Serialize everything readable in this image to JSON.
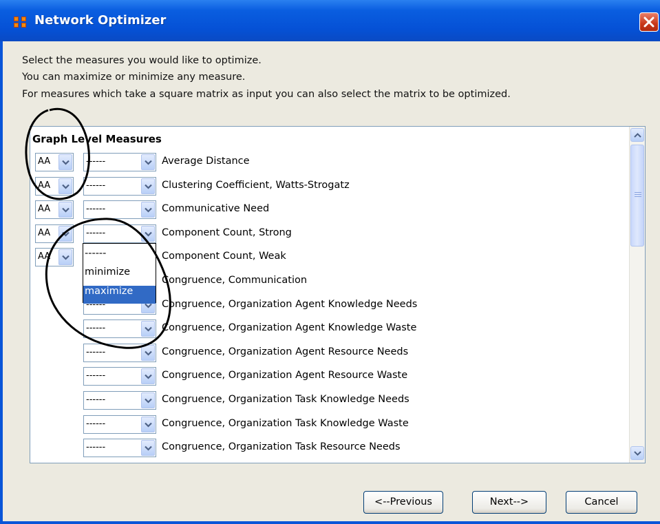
{
  "window": {
    "title": "Network Optimizer"
  },
  "instructions": [
    "Select the measures you would like to optimize.",
    "You can maximize or minimize any measure.",
    "For measures which take a square matrix as input you can also select the matrix to be optimized."
  ],
  "panel": {
    "heading": "Graph Level Measures",
    "rows": [
      {
        "matrix": "AA",
        "goal": "------",
        "label": "Average Distance"
      },
      {
        "matrix": "AA",
        "goal": "------",
        "label": "Clustering Coefficient, Watts-Strogatz"
      },
      {
        "matrix": "AA",
        "goal": "------",
        "label": "Communicative Need"
      },
      {
        "matrix": "AA",
        "goal": "------",
        "label": "Component Count, Strong"
      },
      {
        "matrix": "AA",
        "goal": "------",
        "label": "Component Count, Weak"
      },
      {
        "matrix": "",
        "goal": "------",
        "label": "Congruence, Communication"
      },
      {
        "matrix": "",
        "goal": "------",
        "label": "Congruence, Organization Agent Knowledge Needs"
      },
      {
        "matrix": "",
        "goal": "------",
        "label": "Congruence, Organization Agent Knowledge Waste"
      },
      {
        "matrix": "",
        "goal": "------",
        "label": "Congruence, Organization Agent Resource Needs"
      },
      {
        "matrix": "",
        "goal": "------",
        "label": "Congruence, Organization Agent Resource Waste"
      },
      {
        "matrix": "",
        "goal": "------",
        "label": "Congruence, Organization Task Knowledge Needs"
      },
      {
        "matrix": "",
        "goal": "------",
        "label": "Congruence, Organization Task Knowledge Waste"
      },
      {
        "matrix": "",
        "goal": "------",
        "label": "Congruence, Organization Task Resource Needs"
      }
    ]
  },
  "dropdown": {
    "options": [
      "------",
      "minimize",
      "maximize"
    ],
    "highlighted": "maximize"
  },
  "buttons": {
    "previous": "<--Previous",
    "next": "Next-->",
    "cancel": "Cancel"
  },
  "colors": {
    "titlebar": "#0a55d8",
    "selection": "#316ac5",
    "close": "#c8381a",
    "annotation": "#000000"
  },
  "icons": {
    "app": "network-grid-icon",
    "close": "close-icon",
    "combo_arrow": "chevron-down-icon"
  }
}
